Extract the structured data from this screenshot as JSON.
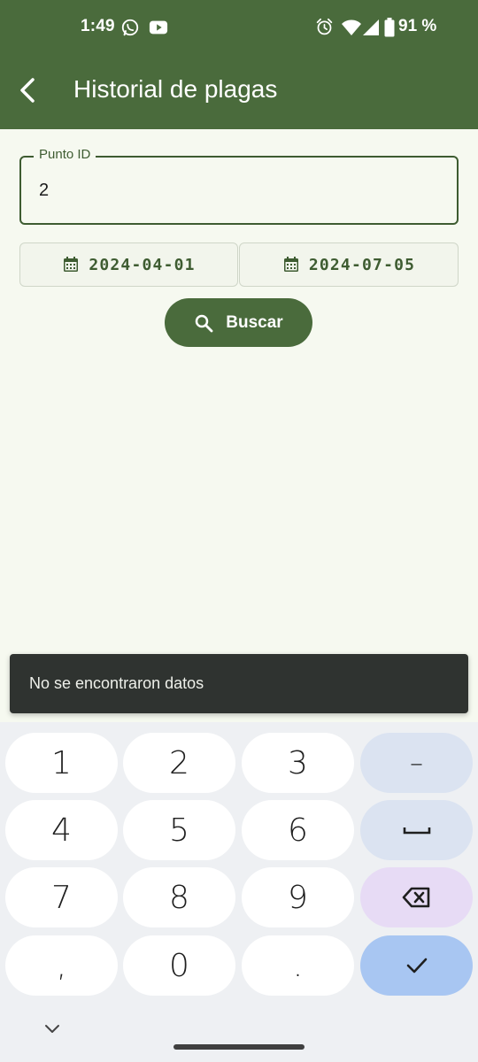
{
  "status_bar": {
    "time": "1:49",
    "battery_percent": "91 %",
    "icons": [
      "whatsapp-icon",
      "youtube-icon",
      "alarm-icon",
      "wifi-icon",
      "signal-icon",
      "battery-icon"
    ]
  },
  "app_bar": {
    "title": "Historial de plagas",
    "back_icon": "back-arrow-icon"
  },
  "form": {
    "punto_id_label": "Punto ID",
    "punto_id_value": "2",
    "start_date": "2024-04-01",
    "end_date": "2024-07-05",
    "search_label": "Buscar"
  },
  "snackbar": {
    "message": "No se encontraron datos"
  },
  "keyboard": {
    "rows": [
      [
        "1",
        "2",
        "3",
        "–"
      ],
      [
        "4",
        "5",
        "6",
        "space"
      ],
      [
        "7",
        "8",
        "9",
        "backspace"
      ],
      [
        ",",
        "0",
        ".",
        "done"
      ]
    ],
    "keys": {
      "k1": "1",
      "k2": "2",
      "k3": "3",
      "minus": "–",
      "k4": "4",
      "k5": "5",
      "k6": "6",
      "k7": "7",
      "k8": "8",
      "k9": "9",
      "comma": ",",
      "k0": "0",
      "dot": "."
    }
  },
  "colors": {
    "primary": "#4a6b3c",
    "background": "#f6f9f0",
    "snackbar": "#2f3330",
    "keyboard_bg": "#eef0f3",
    "key_fn": "#dbe3f1",
    "key_delete": "#e7dbf5",
    "key_done": "#a8c6f2"
  }
}
